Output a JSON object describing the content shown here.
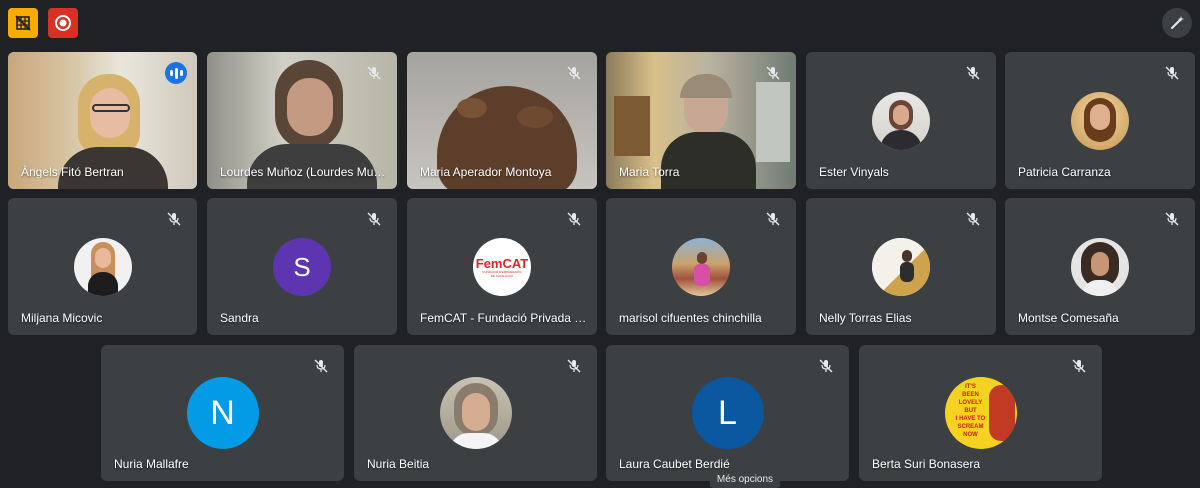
{
  "toolbar": {
    "left_icons": [
      "grid-off-icon",
      "record-icon"
    ],
    "right_icon": "pencil-sparkle-icon"
  },
  "participants": [
    {
      "name": "Àngels Fitó Bertran",
      "type": "video",
      "speaking": true
    },
    {
      "name": "Lourdes Muñoz (Lourdes Muñ...",
      "type": "video",
      "muted": true
    },
    {
      "name": "Maria Aperador Montoya",
      "type": "video",
      "muted": true
    },
    {
      "name": "Maria Torra",
      "type": "video",
      "muted": true
    },
    {
      "name": "Ester Vinyals",
      "type": "photo",
      "muted": true
    },
    {
      "name": "Patricia Carranza",
      "type": "photo",
      "muted": true
    },
    {
      "name": "Miljana Micovic",
      "type": "photo",
      "muted": true
    },
    {
      "name": "Sandra",
      "type": "letter",
      "letter": "S",
      "color": "#5e35b1",
      "muted": true
    },
    {
      "name": "FemCAT - Fundació Privada d...",
      "type": "logo",
      "logo_text": "FemCAT",
      "logo_sub": "FUNDACIÓ D'EMPRESARIS DE CATALUNYA",
      "muted": true
    },
    {
      "name": "marisol cifuentes chinchilla",
      "type": "photo",
      "muted": true
    },
    {
      "name": "Nelly Torras Elias",
      "type": "photo",
      "muted": true
    },
    {
      "name": "Montse Comesaña",
      "type": "photo",
      "muted": true
    },
    {
      "name": "Nuria Mallafre",
      "type": "letter",
      "letter": "N",
      "color": "#039be5",
      "muted": true
    },
    {
      "name": "Nuria Beitia",
      "type": "photo",
      "muted": true
    },
    {
      "name": "Laura Caubet Berdié",
      "type": "letter",
      "letter": "L",
      "color": "#0b57a0",
      "muted": true
    },
    {
      "name": "Berta Suri Bonasera",
      "type": "poster",
      "poster_lines": [
        "IT'S",
        "BEEN",
        "LOVELY",
        "BUT",
        "I HAVE TO",
        "SCREAM",
        "NOW"
      ],
      "muted": true
    }
  ],
  "tooltip": "Més opcions",
  "colors": {
    "background": "#202124",
    "tile": "#3c4043",
    "accent": "#8ab4f8"
  }
}
